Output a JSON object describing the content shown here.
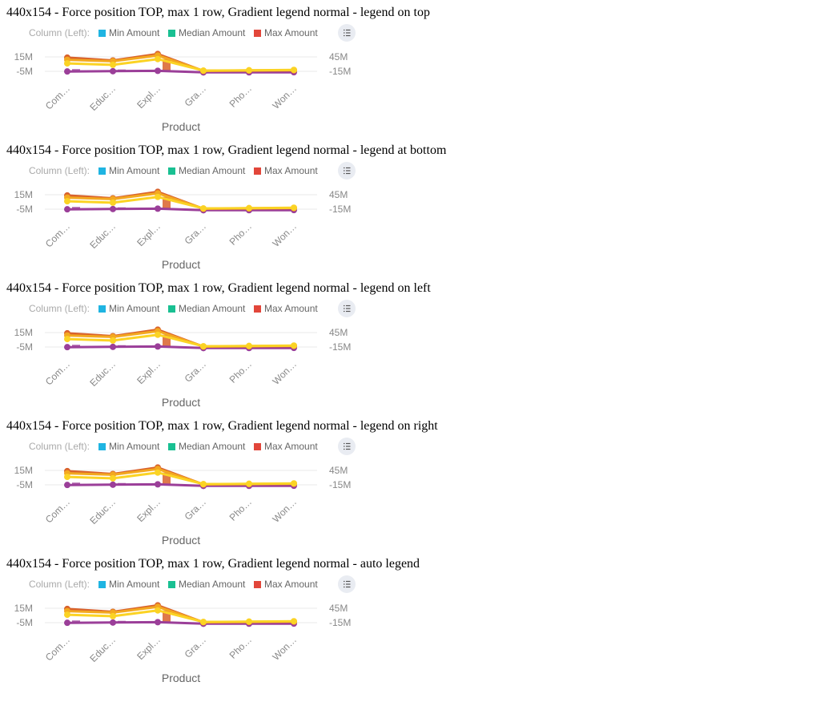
{
  "colors": {
    "min": "#1fb4e2",
    "median": "#19c092",
    "max": "#e2463a",
    "line_dark": "#9b3f99",
    "line_mid": "#d9622c",
    "line_light": "#f3a820",
    "line_yellow": "#fbd324",
    "grid": "#e8e8e8",
    "toggle_bg": "#e9ecf2",
    "toggle_icon": "#555555"
  },
  "icons": {
    "legend_toggle": "list-icon"
  },
  "blocks": [
    {
      "title": "440x154 - Force position TOP, max 1 row, Gradient legend normal - legend on top"
    },
    {
      "title": "440x154 - Force position TOP, max 1 row, Gradient legend normal - legend at bottom"
    },
    {
      "title": "440x154 - Force position TOP, max 1 row, Gradient legend normal - legend on left"
    },
    {
      "title": "440x154 - Force position TOP, max 1 row, Gradient legend normal - legend on right"
    },
    {
      "title": "440x154 - Force position TOP, max 1 row, Gradient legend normal - auto legend"
    }
  ],
  "legend": {
    "prefix": "Column (Left):",
    "items": [
      {
        "label": "Min Amount",
        "color_key": "min"
      },
      {
        "label": "Median Amount",
        "color_key": "median"
      },
      {
        "label": "Max Amount",
        "color_key": "max"
      }
    ]
  },
  "chart_data": {
    "type": "line",
    "categories": [
      "Com…",
      "Educ…",
      "Expl…",
      "Gra…",
      "Pho…",
      "Won…"
    ],
    "xlabel": "Product",
    "y_left": {
      "ticks": [
        "15M",
        "-5M"
      ],
      "tick_values": [
        15000000,
        -5000000
      ]
    },
    "y_right": {
      "ticks": [
        "45M",
        "-15M"
      ],
      "tick_values": [
        45000000,
        -15000000
      ]
    },
    "series": [
      {
        "color_key": "line_dark",
        "values": [
          -5200000,
          -4800000,
          -4300000,
          -6500000,
          -6400000,
          -6300000
        ]
      },
      {
        "color_key": "line_mid",
        "values": [
          14000000,
          10000000,
          19000000,
          -4500000,
          -4000000,
          -3500000
        ]
      },
      {
        "color_key": "line_light",
        "values": [
          11000000,
          9000000,
          17000000,
          -4200000,
          -3800000,
          -3300000
        ]
      },
      {
        "color_key": "line_yellow",
        "values": [
          6000000,
          4000000,
          12000000,
          -4000000,
          -3500000,
          -3000000
        ]
      }
    ],
    "bar_marks": [
      {
        "category_index": 0,
        "color_key": "line_dark",
        "value": -2000000
      },
      {
        "category_index": 1,
        "color_key": "line_dark",
        "value": -2500000
      },
      {
        "category_index": 2,
        "color_key": "line_mid",
        "value": 12000000
      }
    ]
  }
}
